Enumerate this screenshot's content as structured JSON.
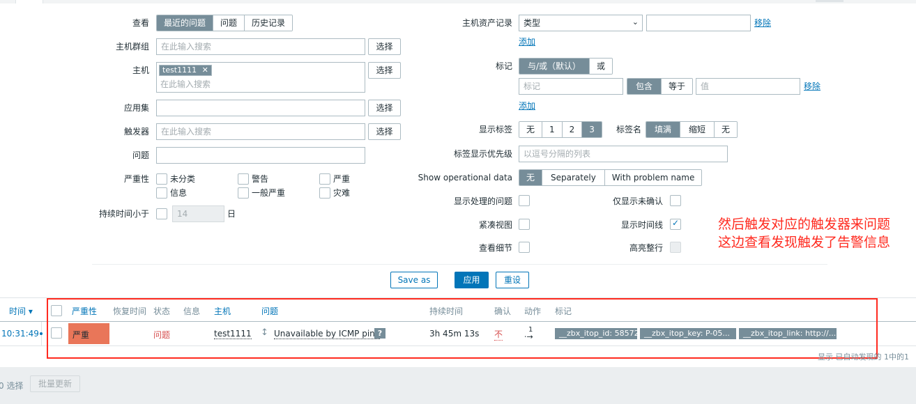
{
  "filter": {
    "view_label": "查看",
    "view_tabs": [
      "最近的问题",
      "问题",
      "历史记录"
    ],
    "host_group_label": "主机群组",
    "host_group_placeholder": "在此输入搜索",
    "select_label": "选择",
    "host_label": "主机",
    "host_chip": "test1111",
    "host_placeholder": "在此输入搜索",
    "app_label": "应用集",
    "trigger_label": "触发器",
    "trigger_placeholder": "在此输入搜索",
    "problem_label": "问题",
    "severity_label": "严重性",
    "severities": [
      "未分类",
      "警告",
      "严重",
      "信息",
      "一般严重",
      "灾难"
    ],
    "age_label": "持续时间小于",
    "age_value": "14",
    "age_unit": "日",
    "inventory_label": "主机资产记录",
    "inventory_select": "类型",
    "remove_label": "移除",
    "add_label": "添加",
    "tags_label": "标记",
    "tags_eval": [
      "与/或（默认）",
      "或"
    ],
    "tag_placeholder": "标记",
    "tag_operators": [
      "包含",
      "等于"
    ],
    "value_placeholder": "值",
    "show_tags_label": "显示标签",
    "show_tags_options": [
      "无",
      "1",
      "2",
      "3"
    ],
    "tag_name_label": "标签名",
    "tag_name_options": [
      "填满",
      "缩短",
      "无"
    ],
    "tag_priority_label": "标签显示优先级",
    "tag_priority_placeholder": "以逗号分隔的列表",
    "opdata_label": "Show operational data",
    "opdata_options": [
      "无",
      "Separately",
      "With problem name"
    ],
    "show_suppressed_label": "显示处理的问题",
    "unack_label": "仅显示未确认",
    "compact_label": "紧凑视图",
    "timeline_label": "显示时间线",
    "details_label": "查看细节",
    "highlight_label": "高亮整行",
    "save_as_label": "Save as",
    "apply_label": "应用",
    "reset_label": "重设"
  },
  "annotation": {
    "line1": "然后触发对应的触发器来问题",
    "line2": "这边查看发现触发了告警信息"
  },
  "table": {
    "time_header": "时间 ▾",
    "headers": [
      "严重性",
      "恢复时间",
      "状态",
      "信息",
      "主机",
      "问题",
      "持续时间",
      "确认",
      "动作",
      "标记"
    ],
    "row": {
      "time": "10:31:49",
      "severity": "严重",
      "status": "问题",
      "host": "test1111",
      "problem": "Unavailable by ICMP ping",
      "duration": "3h 45m 13s",
      "ack": "不",
      "actions": "1",
      "tags": [
        "__zbx_itop_id: 58572",
        "__zbx_itop_key: P-05...",
        "__zbx_itop_link: http://..."
      ]
    },
    "footer_text": "显示 已自动发现的 1中的1"
  },
  "bottom": {
    "selected_text": "0 选择",
    "mass_update_label": "批量更新"
  },
  "colors": {
    "severity_high": "#e97659",
    "accent": "#0275b8",
    "annotation_red": "#ff2a1f",
    "segment_active": "#768d99"
  }
}
